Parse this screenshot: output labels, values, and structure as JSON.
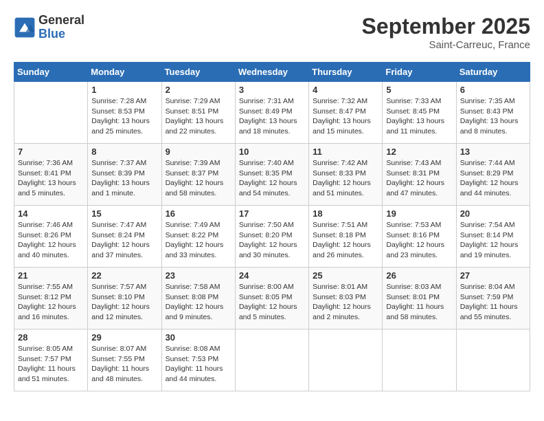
{
  "header": {
    "logo_general": "General",
    "logo_blue": "Blue",
    "month_title": "September 2025",
    "location": "Saint-Carreuc, France"
  },
  "calendar": {
    "days_of_week": [
      "Sunday",
      "Monday",
      "Tuesday",
      "Wednesday",
      "Thursday",
      "Friday",
      "Saturday"
    ],
    "weeks": [
      [
        {
          "day": "",
          "info": ""
        },
        {
          "day": "1",
          "info": "Sunrise: 7:28 AM\nSunset: 8:53 PM\nDaylight: 13 hours\nand 25 minutes."
        },
        {
          "day": "2",
          "info": "Sunrise: 7:29 AM\nSunset: 8:51 PM\nDaylight: 13 hours\nand 22 minutes."
        },
        {
          "day": "3",
          "info": "Sunrise: 7:31 AM\nSunset: 8:49 PM\nDaylight: 13 hours\nand 18 minutes."
        },
        {
          "day": "4",
          "info": "Sunrise: 7:32 AM\nSunset: 8:47 PM\nDaylight: 13 hours\nand 15 minutes."
        },
        {
          "day": "5",
          "info": "Sunrise: 7:33 AM\nSunset: 8:45 PM\nDaylight: 13 hours\nand 11 minutes."
        },
        {
          "day": "6",
          "info": "Sunrise: 7:35 AM\nSunset: 8:43 PM\nDaylight: 13 hours\nand 8 minutes."
        }
      ],
      [
        {
          "day": "7",
          "info": "Sunrise: 7:36 AM\nSunset: 8:41 PM\nDaylight: 13 hours\nand 5 minutes."
        },
        {
          "day": "8",
          "info": "Sunrise: 7:37 AM\nSunset: 8:39 PM\nDaylight: 13 hours\nand 1 minute."
        },
        {
          "day": "9",
          "info": "Sunrise: 7:39 AM\nSunset: 8:37 PM\nDaylight: 12 hours\nand 58 minutes."
        },
        {
          "day": "10",
          "info": "Sunrise: 7:40 AM\nSunset: 8:35 PM\nDaylight: 12 hours\nand 54 minutes."
        },
        {
          "day": "11",
          "info": "Sunrise: 7:42 AM\nSunset: 8:33 PM\nDaylight: 12 hours\nand 51 minutes."
        },
        {
          "day": "12",
          "info": "Sunrise: 7:43 AM\nSunset: 8:31 PM\nDaylight: 12 hours\nand 47 minutes."
        },
        {
          "day": "13",
          "info": "Sunrise: 7:44 AM\nSunset: 8:29 PM\nDaylight: 12 hours\nand 44 minutes."
        }
      ],
      [
        {
          "day": "14",
          "info": "Sunrise: 7:46 AM\nSunset: 8:26 PM\nDaylight: 12 hours\nand 40 minutes."
        },
        {
          "day": "15",
          "info": "Sunrise: 7:47 AM\nSunset: 8:24 PM\nDaylight: 12 hours\nand 37 minutes."
        },
        {
          "day": "16",
          "info": "Sunrise: 7:49 AM\nSunset: 8:22 PM\nDaylight: 12 hours\nand 33 minutes."
        },
        {
          "day": "17",
          "info": "Sunrise: 7:50 AM\nSunset: 8:20 PM\nDaylight: 12 hours\nand 30 minutes."
        },
        {
          "day": "18",
          "info": "Sunrise: 7:51 AM\nSunset: 8:18 PM\nDaylight: 12 hours\nand 26 minutes."
        },
        {
          "day": "19",
          "info": "Sunrise: 7:53 AM\nSunset: 8:16 PM\nDaylight: 12 hours\nand 23 minutes."
        },
        {
          "day": "20",
          "info": "Sunrise: 7:54 AM\nSunset: 8:14 PM\nDaylight: 12 hours\nand 19 minutes."
        }
      ],
      [
        {
          "day": "21",
          "info": "Sunrise: 7:55 AM\nSunset: 8:12 PM\nDaylight: 12 hours\nand 16 minutes."
        },
        {
          "day": "22",
          "info": "Sunrise: 7:57 AM\nSunset: 8:10 PM\nDaylight: 12 hours\nand 12 minutes."
        },
        {
          "day": "23",
          "info": "Sunrise: 7:58 AM\nSunset: 8:08 PM\nDaylight: 12 hours\nand 9 minutes."
        },
        {
          "day": "24",
          "info": "Sunrise: 8:00 AM\nSunset: 8:05 PM\nDaylight: 12 hours\nand 5 minutes."
        },
        {
          "day": "25",
          "info": "Sunrise: 8:01 AM\nSunset: 8:03 PM\nDaylight: 12 hours\nand 2 minutes."
        },
        {
          "day": "26",
          "info": "Sunrise: 8:03 AM\nSunset: 8:01 PM\nDaylight: 11 hours\nand 58 minutes."
        },
        {
          "day": "27",
          "info": "Sunrise: 8:04 AM\nSunset: 7:59 PM\nDaylight: 11 hours\nand 55 minutes."
        }
      ],
      [
        {
          "day": "28",
          "info": "Sunrise: 8:05 AM\nSunset: 7:57 PM\nDaylight: 11 hours\nand 51 minutes."
        },
        {
          "day": "29",
          "info": "Sunrise: 8:07 AM\nSunset: 7:55 PM\nDaylight: 11 hours\nand 48 minutes."
        },
        {
          "day": "30",
          "info": "Sunrise: 8:08 AM\nSunset: 7:53 PM\nDaylight: 11 hours\nand 44 minutes."
        },
        {
          "day": "",
          "info": ""
        },
        {
          "day": "",
          "info": ""
        },
        {
          "day": "",
          "info": ""
        },
        {
          "day": "",
          "info": ""
        }
      ]
    ]
  }
}
